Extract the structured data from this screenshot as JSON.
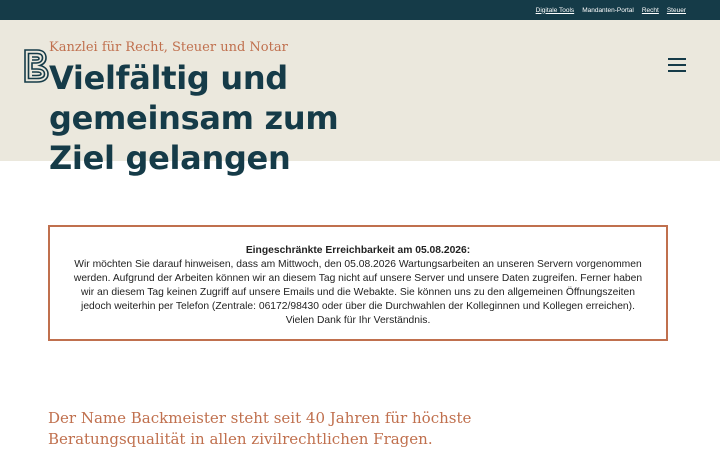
{
  "topnav": {
    "items": [
      {
        "label": "Digitale Tools"
      },
      {
        "label": "Mandanten-Portal"
      },
      {
        "label": "Recht"
      },
      {
        "label": "Steuer"
      }
    ]
  },
  "hero": {
    "tagline": "Kanzlei für Recht, Steuer und Notar",
    "headline": "Vielfältig und gemeinsam zum Ziel gelangen",
    "logo_icon": "b-monogram-logo",
    "menu_icon": "hamburger-icon"
  },
  "notice": {
    "title": "Eingeschränkte Erreichbarkeit am 05.08.2026:",
    "body": "Wir möchten Sie darauf hinweisen, dass am Mittwoch, den 05.08.2026 Wartungsarbeiten an unseren Servern vorgenommen werden. Aufgrund der Arbeiten können wir an diesem Tag nicht auf unsere Server und unsere Daten zugreifen. Ferner haben wir an diesem Tag keinen Zugriff auf unsere Emails und die Webakte. Sie können uns zu den allgemeinen Öffnungszeiten jedoch weiterhin per Telefon (Zentrale: 06172/98430 oder über die Durchwahlen der Kolleginnen und Kollegen erreichen).",
    "thanks": "Vielen Dank für Ihr Verständnis."
  },
  "intro": {
    "text": "Der Name Backmeister steht seit 40 Jahren für höchste Beratungsqualität in allen zivilrechtlichen Fragen."
  },
  "colors": {
    "navy": "#153b48",
    "sand": "#ebe8dd",
    "accent": "#c0704e"
  }
}
